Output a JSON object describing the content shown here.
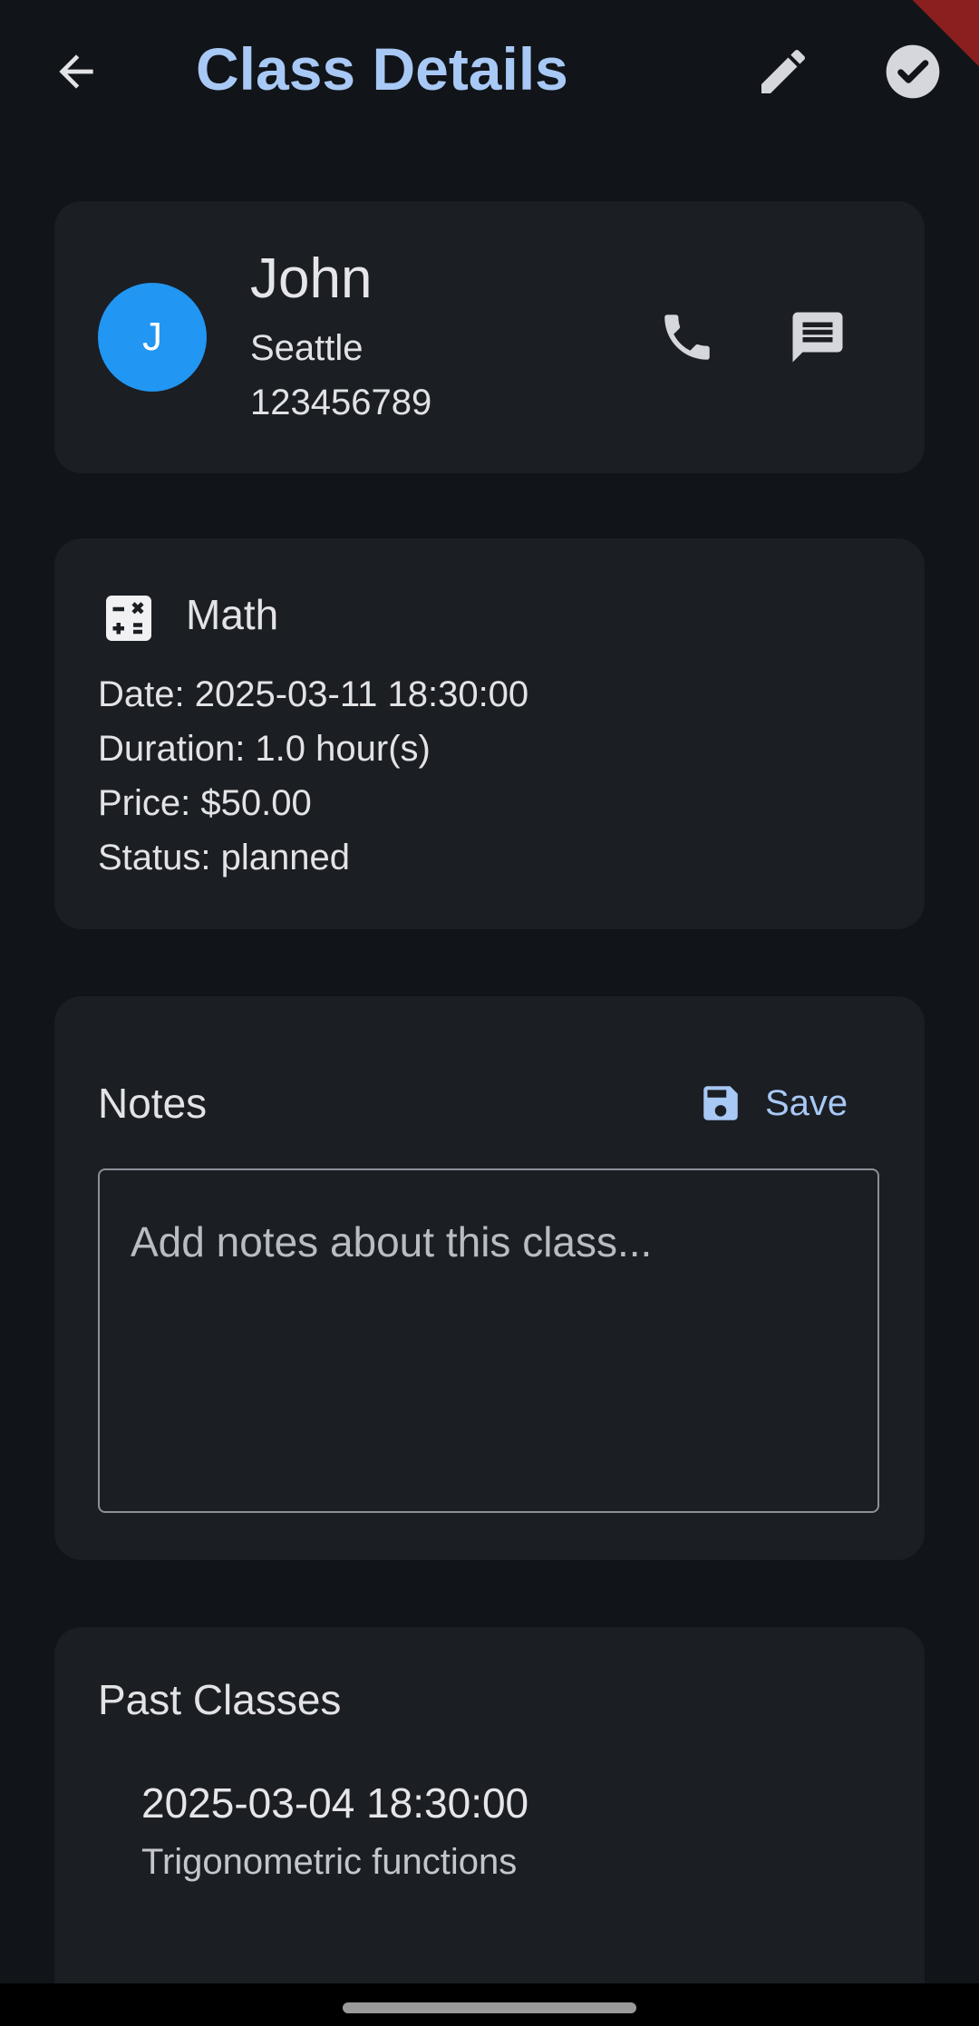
{
  "appbar": {
    "title": "Class Details",
    "back_icon": "arrow-back-icon",
    "edit_icon": "pencil-icon",
    "done_icon": "check-circle-icon"
  },
  "student": {
    "avatar_initial": "J",
    "name": "John",
    "city": "Seattle",
    "phone": "123456789",
    "avatar_color": "#2196f3"
  },
  "lesson": {
    "subject": "Math",
    "subject_icon": "calculator-icon",
    "date_line": "Date: 2025-03-11 18:30:00",
    "duration_line": "Duration: 1.0 hour(s)",
    "price_line": "Price: $50.00",
    "status_line": "Status: planned"
  },
  "notes": {
    "title": "Notes",
    "save_label": "Save",
    "placeholder": "Add notes about this class...",
    "value": ""
  },
  "past_classes": {
    "title": "Past Classes",
    "items": [
      {
        "date": "2025-03-04 18:30:00",
        "topic": "Trigonometric functions"
      }
    ]
  },
  "colors": {
    "accent": "#a8c8f5",
    "background": "#111418",
    "card": "#1b1e23"
  }
}
